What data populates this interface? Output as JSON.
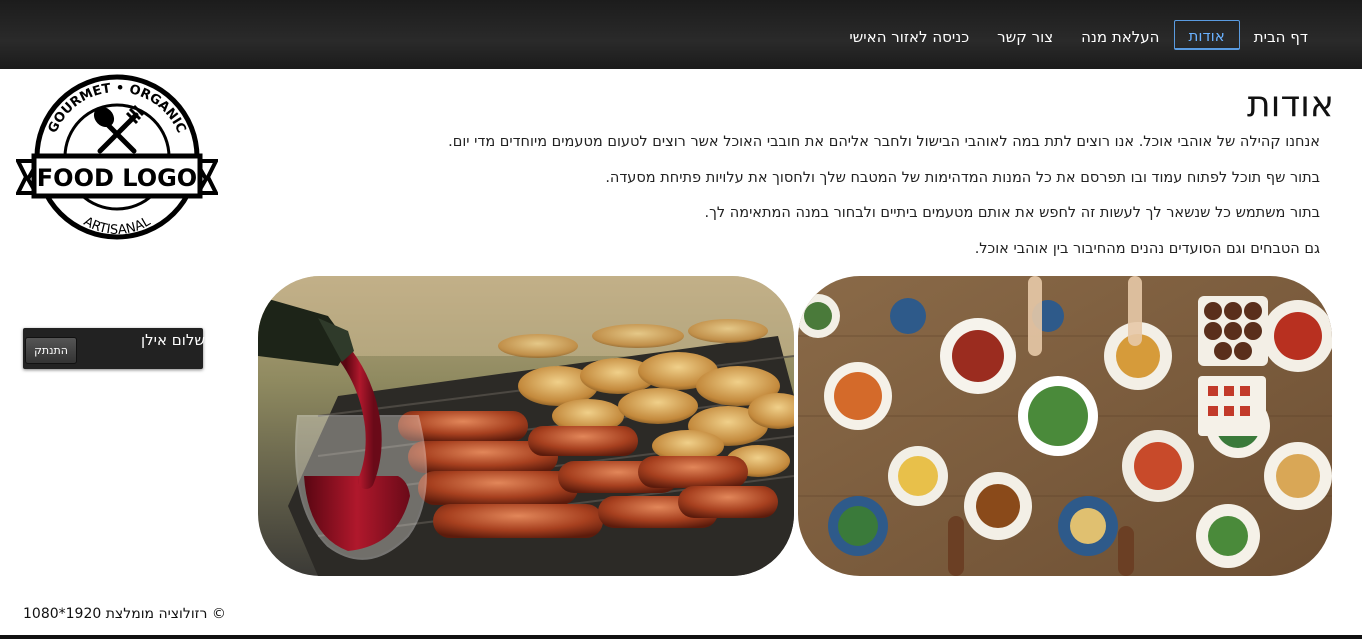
{
  "nav": {
    "items": [
      {
        "label": "דף הבית",
        "active": false
      },
      {
        "label": "אודות",
        "active": true
      },
      {
        "label": "העלאת מנה",
        "active": false
      },
      {
        "label": "צור קשר",
        "active": false
      },
      {
        "label": "כניסה לאזור האישי",
        "active": false
      }
    ],
    "accent_color": "#5a9be0"
  },
  "logo": {
    "top_arc": "GOURMET • ORGANIC",
    "main": "FOOD LOGO",
    "bottom_arc": "ARTISANAL"
  },
  "about": {
    "title": "אודות",
    "paragraphs": [
      "אנחנו קהילה של אוהבי אוכל. אנו רוצים לתת במה לאוהבי הבישול ולחבר אליהם את חובבי האוכל אשר רוצים לטעום מטעמים מיוחדים מדי יום.",
      "בתור שף תוכל לפתוח עמוד ובו תפרסם את כל המנות המדהימות של המטבח שלך ולחסוך את עלויות פתיחת מסעדה.",
      "בתור משתמש כל שנשאר לך לעשות זה לחפש את אותם מטעמים ביתיים ולבחור במנה המתאימה לך.",
      "גם הטבחים וגם הסועדים נהנים מהחיבור בין אוהבי אוכל."
    ]
  },
  "user": {
    "greeting": "שלום אילן",
    "logout_label": "התנתק"
  },
  "images": {
    "grill": "grill-and-wine-photo",
    "table": "food-table-photo"
  },
  "footer": {
    "text": "© רזולוציה מומלצת 1920*1080"
  }
}
